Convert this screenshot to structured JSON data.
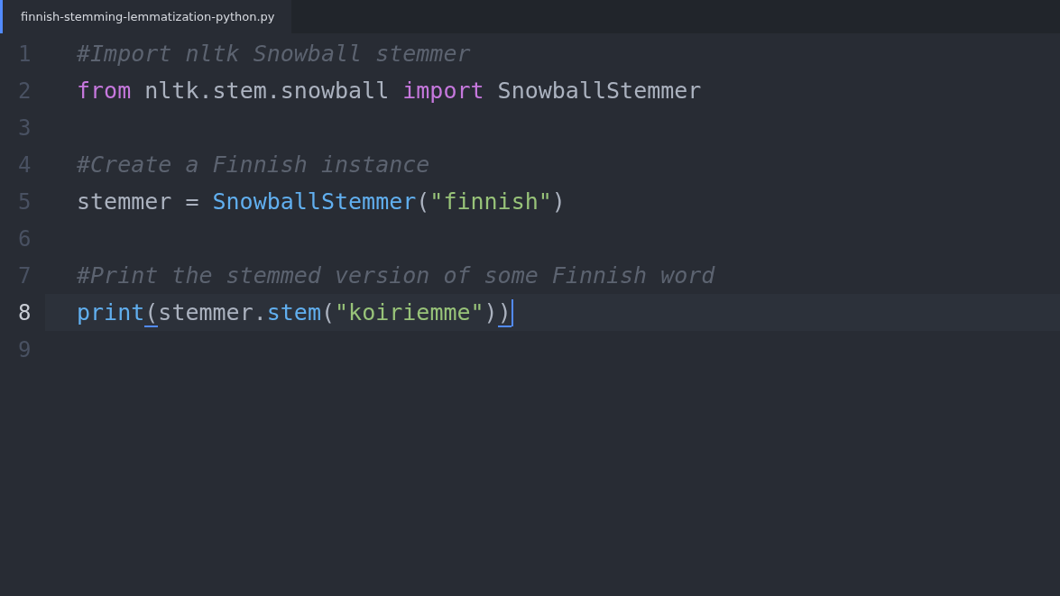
{
  "tab": {
    "title": "finnish-stemming-lemmatization-python.py",
    "selected": true
  },
  "lines": [
    {
      "number": "1",
      "current": false,
      "tokens": [
        {
          "kind": "comment",
          "text": "#Import nltk Snowball stemmer"
        }
      ]
    },
    {
      "number": "2",
      "current": false,
      "tokens": [
        {
          "kind": "keyword",
          "text": "from"
        },
        {
          "kind": "plain",
          "text": " nltk.stem.snowball "
        },
        {
          "kind": "keyword",
          "text": "import"
        },
        {
          "kind": "plain",
          "text": " SnowballStemmer"
        }
      ]
    },
    {
      "number": "3",
      "current": false
    },
    {
      "number": "4",
      "current": false,
      "tokens": [
        {
          "kind": "comment",
          "text": "#Create a Finnish instance"
        }
      ]
    },
    {
      "number": "5",
      "current": false,
      "tokens": [
        {
          "kind": "plain",
          "text": "stemmer = "
        },
        {
          "kind": "func",
          "text": "SnowballStemmer"
        },
        {
          "kind": "plain",
          "text": "("
        },
        {
          "kind": "string",
          "text": "\"finnish\""
        },
        {
          "kind": "plain",
          "text": ")"
        }
      ]
    },
    {
      "number": "6",
      "current": false
    },
    {
      "number": "7",
      "current": false,
      "tokens": [
        {
          "kind": "comment",
          "text": "#Print the stemmed version of some Finnish word"
        }
      ]
    },
    {
      "number": "8",
      "current": true,
      "tokens": [
        {
          "kind": "func",
          "text": "print"
        },
        {
          "kind": "plain",
          "text": "(",
          "matched": true
        },
        {
          "kind": "plain",
          "text": "stemmer."
        },
        {
          "kind": "func",
          "text": "stem"
        },
        {
          "kind": "plain",
          "text": "("
        },
        {
          "kind": "string",
          "text": "\"koiriemme\""
        },
        {
          "kind": "plain",
          "text": ")"
        },
        {
          "kind": "plain",
          "text": ")",
          "matched": true,
          "cursor": true
        }
      ]
    },
    {
      "number": "9",
      "current": false
    }
  ]
}
